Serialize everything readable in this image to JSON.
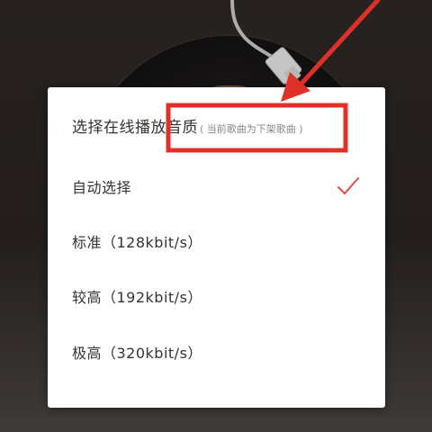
{
  "dialog": {
    "title": "选择在线播放音质",
    "note": "( 当前歌曲为下架歌曲 )",
    "selected_index": 0,
    "options": [
      {
        "label": "自动选择",
        "selected": true
      },
      {
        "label": "标准（128kbit/s）",
        "selected": false
      },
      {
        "label": "较高（192kbit/s）",
        "selected": false
      },
      {
        "label": "极高（320kbit/s）",
        "selected": false
      }
    ]
  },
  "colors": {
    "accent": "#e24a43",
    "annotation": "#e0302a",
    "dialog_bg": "#ffffff",
    "text_primary": "#333333",
    "text_secondary": "#888888"
  },
  "icons": {
    "check": "check-icon",
    "annotation_arrow": "arrow-icon"
  }
}
